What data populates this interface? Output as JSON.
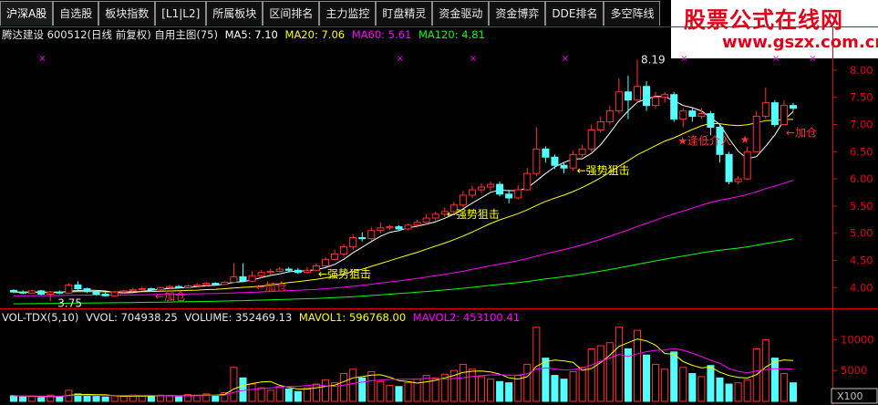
{
  "tabs": [
    "沪深A股",
    "自选股",
    "板块指数",
    "[L1|L2]",
    "所属板块",
    "区间排名",
    "主力监控",
    "盯盘精灵",
    "资金驱动",
    "资金博弈",
    "DDE排名",
    "多空阵线"
  ],
  "watermark": {
    "title": "股票公式在线网",
    "url": "www.gszx.com.cn"
  },
  "header": {
    "stock": "腾达建设 600512(日线 前复权) 自用主图(75)",
    "ma5": "MA5: 7.10",
    "ma20": "MA20: 7.06",
    "ma60": "MA60: 5.61",
    "ma120": "MA120: 4.81"
  },
  "volume_header": {
    "name": "VOL-TDX(5,10)",
    "vvol": "VVOL: 704938.25",
    "volume": "VOLUME: 352469.13",
    "mavol1": "MAVOL1: 596768.00",
    "mavol2": "MAVOL2: 453100.41"
  },
  "annotations": {
    "high": "8.19",
    "low": "3.75",
    "strong1": "←强势狙击",
    "strong2": "←强势狙击",
    "strong3": "←强势狙击",
    "add1": "←加仓",
    "add2": "←加仓",
    "add3": "←加仓",
    "buy": "★逢低介入",
    "star": "★"
  },
  "colors": {
    "up": "#ff3232",
    "down": "#54ffff",
    "ma5": "#ffffff",
    "ma20": "#ffff00",
    "ma60": "#ff00ff",
    "ma120": "#00ff00",
    "axis": "#e0001a"
  },
  "chart_data": {
    "type": "candlestick",
    "price_axis": {
      "ticks": [
        "8.00",
        "7.50",
        "7.00",
        "6.50",
        "6.00",
        "5.50",
        "5.00",
        "4.50",
        "4.00"
      ],
      "range": [
        3.62,
        8.25
      ]
    },
    "volume_axis": {
      "ticks": [
        "10000",
        "5000"
      ],
      "unit": "X100",
      "range": [
        0,
        13000
      ]
    },
    "candles": [
      [
        3.95,
        3.92,
        3.97,
        3.9
      ],
      [
        3.92,
        3.9,
        3.95,
        3.88
      ],
      [
        3.9,
        3.94,
        3.96,
        3.88
      ],
      [
        3.94,
        3.88,
        3.96,
        3.86
      ],
      [
        3.88,
        3.92,
        3.94,
        3.75
      ],
      [
        3.92,
        3.9,
        3.95,
        3.88
      ],
      [
        3.9,
        4.05,
        4.08,
        3.89
      ],
      [
        4.05,
        3.98,
        4.12,
        3.96
      ],
      [
        3.98,
        3.93,
        4.0,
        3.9
      ],
      [
        3.93,
        3.88,
        3.95,
        3.86
      ],
      [
        3.88,
        3.85,
        3.92,
        3.84
      ],
      [
        3.85,
        3.92,
        3.94,
        3.84
      ],
      [
        3.92,
        3.94,
        3.96,
        3.9
      ],
      [
        3.94,
        3.96,
        4.0,
        3.92
      ],
      [
        3.96,
        3.98,
        4.02,
        3.94
      ],
      [
        3.98,
        3.96,
        4.0,
        3.94
      ],
      [
        3.96,
        4.0,
        4.02,
        3.94
      ],
      [
        4.0,
        4.02,
        4.05,
        3.98
      ],
      [
        4.02,
        4.0,
        4.05,
        3.98
      ],
      [
        4.0,
        4.03,
        4.06,
        3.99
      ],
      [
        4.03,
        4.05,
        4.08,
        4.01
      ],
      [
        4.05,
        4.08,
        4.1,
        4.03
      ],
      [
        4.08,
        4.06,
        4.1,
        4.04
      ],
      [
        4.06,
        4.1,
        4.12,
        4.05
      ],
      [
        4.1,
        4.2,
        4.45,
        4.08
      ],
      [
        4.2,
        4.12,
        4.45,
        4.1
      ],
      [
        4.12,
        4.22,
        4.3,
        4.1
      ],
      [
        4.22,
        4.28,
        4.32,
        4.18
      ],
      [
        4.28,
        4.3,
        4.35,
        4.24
      ],
      [
        4.3,
        4.34,
        4.38,
        4.28
      ],
      [
        4.34,
        4.32,
        4.38,
        4.28
      ],
      [
        4.32,
        4.28,
        4.36,
        4.25
      ],
      [
        4.28,
        4.32,
        4.38,
        4.26
      ],
      [
        4.32,
        4.4,
        4.45,
        4.3
      ],
      [
        4.4,
        4.52,
        4.56,
        4.38
      ],
      [
        4.52,
        4.62,
        4.7,
        4.5
      ],
      [
        4.62,
        4.75,
        4.8,
        4.58
      ],
      [
        4.75,
        4.92,
        4.98,
        4.7
      ],
      [
        4.92,
        4.9,
        5.02,
        4.85
      ],
      [
        4.9,
        5.05,
        5.12,
        4.86
      ],
      [
        5.05,
        5.1,
        5.2,
        5.0
      ],
      [
        5.1,
        5.12,
        5.15,
        5.06
      ],
      [
        5.12,
        5.08,
        5.15,
        5.04
      ],
      [
        5.08,
        5.15,
        5.18,
        5.05
      ],
      [
        5.15,
        5.2,
        5.25,
        5.1
      ],
      [
        5.2,
        5.28,
        5.35,
        5.16
      ],
      [
        5.28,
        5.35,
        5.4,
        5.24
      ],
      [
        5.35,
        5.4,
        5.48,
        5.3
      ],
      [
        5.4,
        5.52,
        5.58,
        5.36
      ],
      [
        5.52,
        5.7,
        5.78,
        5.48
      ],
      [
        5.7,
        5.8,
        5.88,
        5.65
      ],
      [
        5.8,
        5.85,
        5.92,
        5.74
      ],
      [
        5.85,
        5.9,
        5.95,
        5.78
      ],
      [
        5.9,
        5.72,
        5.95,
        5.68
      ],
      [
        5.72,
        5.65,
        5.8,
        5.55
      ],
      [
        5.65,
        5.8,
        5.88,
        5.62
      ],
      [
        5.8,
        6.1,
        6.2,
        5.78
      ],
      [
        6.1,
        6.55,
        6.95,
        6.05
      ],
      [
        6.55,
        6.4,
        6.6,
        6.3
      ],
      [
        6.4,
        6.25,
        6.45,
        6.18
      ],
      [
        6.25,
        6.2,
        6.3,
        6.1
      ],
      [
        6.2,
        6.45,
        6.52,
        6.15
      ],
      [
        6.45,
        6.55,
        6.62,
        6.4
      ],
      [
        6.55,
        6.9,
        7.0,
        6.5
      ],
      [
        6.9,
        7.05,
        7.15,
        6.85
      ],
      [
        7.05,
        7.25,
        7.35,
        7.0
      ],
      [
        7.25,
        7.6,
        7.85,
        7.2
      ],
      [
        7.6,
        7.45,
        7.9,
        7.1
      ],
      [
        7.45,
        7.7,
        8.19,
        7.4
      ],
      [
        7.7,
        7.35,
        7.8,
        7.25
      ],
      [
        7.35,
        7.5,
        7.6,
        7.3
      ],
      [
        7.5,
        7.55,
        7.6,
        7.4
      ],
      [
        7.55,
        7.1,
        7.6,
        7.05
      ],
      [
        7.1,
        7.25,
        7.3,
        6.95
      ],
      [
        7.25,
        7.15,
        7.3,
        7.05
      ],
      [
        7.15,
        7.2,
        7.3,
        7.1
      ],
      [
        7.2,
        6.95,
        7.25,
        6.8
      ],
      [
        6.95,
        6.45,
        7.0,
        6.3
      ],
      [
        6.45,
        5.95,
        6.5,
        5.9
      ],
      [
        5.95,
        6.0,
        6.05,
        5.9
      ],
      [
        6.0,
        6.5,
        6.6,
        5.98
      ],
      [
        6.5,
        7.15,
        7.25,
        6.5
      ],
      [
        7.15,
        7.4,
        7.68,
        7.1
      ],
      [
        7.4,
        7.0,
        7.45,
        6.95
      ],
      [
        7.0,
        7.35,
        7.45,
        7.0
      ],
      [
        7.35,
        7.3,
        7.4,
        7.25
      ]
    ],
    "volume": [
      900,
      700,
      800,
      600,
      1000,
      700,
      1800,
      1200,
      900,
      800,
      700,
      900,
      800,
      1000,
      900,
      800,
      1000,
      900,
      800,
      1100,
      1000,
      1200,
      900,
      1400,
      5500,
      3800,
      2800,
      2200,
      1800,
      2400,
      2000,
      1600,
      2200,
      2800,
      3500,
      3000,
      4500,
      5200,
      3800,
      4800,
      3200,
      2600,
      2400,
      3000,
      3600,
      4200,
      3800,
      4400,
      5000,
      6000,
      5200,
      4000,
      3600,
      3200,
      3000,
      4200,
      6000,
      12000,
      7000,
      4200,
      3600,
      4800,
      5500,
      8500,
      9000,
      9500,
      12000,
      8500,
      11500,
      7500,
      6000,
      5200,
      8000,
      5500,
      4500,
      4000,
      5800,
      3800,
      2800,
      3000,
      3500,
      8500,
      10000,
      7000,
      4500,
      3000
    ]
  }
}
